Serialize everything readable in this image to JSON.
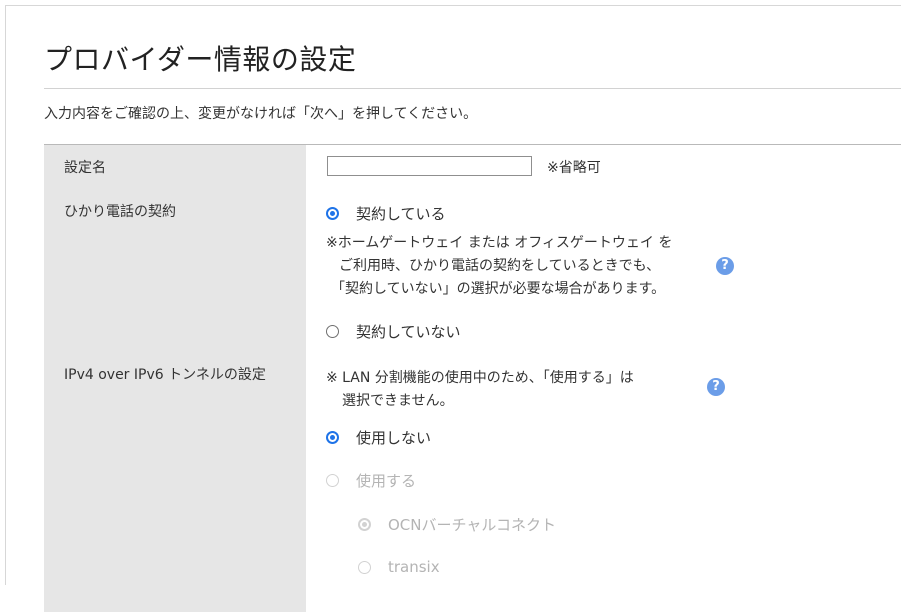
{
  "page": {
    "title": "プロバイダー情報の設定",
    "intro": "入力内容をご確認の上、変更がなければ「次へ」を押してください。"
  },
  "rows": {
    "setting_name": {
      "label": "設定名",
      "input_value": "",
      "optional_note": "※省略可"
    },
    "hikari_contract": {
      "label": "ひかり電話の契約",
      "option_yes": "契約している",
      "option_yes_selected": true,
      "note_lines": [
        "※ホームゲートウェイ または オフィスゲートウェイ を",
        "ご利用時、ひかり電話の契約をしているときでも、",
        "「契約していない」の選択が必要な場合があります。"
      ],
      "help_icon": "?",
      "option_no": "契約していない"
    },
    "ipv4_over_ipv6": {
      "label": "IPv4 over IPv6 トンネルの設定",
      "note_lines": [
        "※ LAN 分割機能の使用中のため、「使用する」は",
        "選択できません。"
      ],
      "help_icon": "?",
      "option_not_use": "使用しない",
      "option_not_use_selected": true,
      "option_use": "使用する",
      "sub_option_ocn": "OCNバーチャルコネクト",
      "sub_option_transix": "transix"
    }
  },
  "colors": {
    "accent": "#1e73e8",
    "help_icon": "#6b9de8",
    "label_bg": "#e6e6e6",
    "disabled_text": "#b4b4b4"
  }
}
